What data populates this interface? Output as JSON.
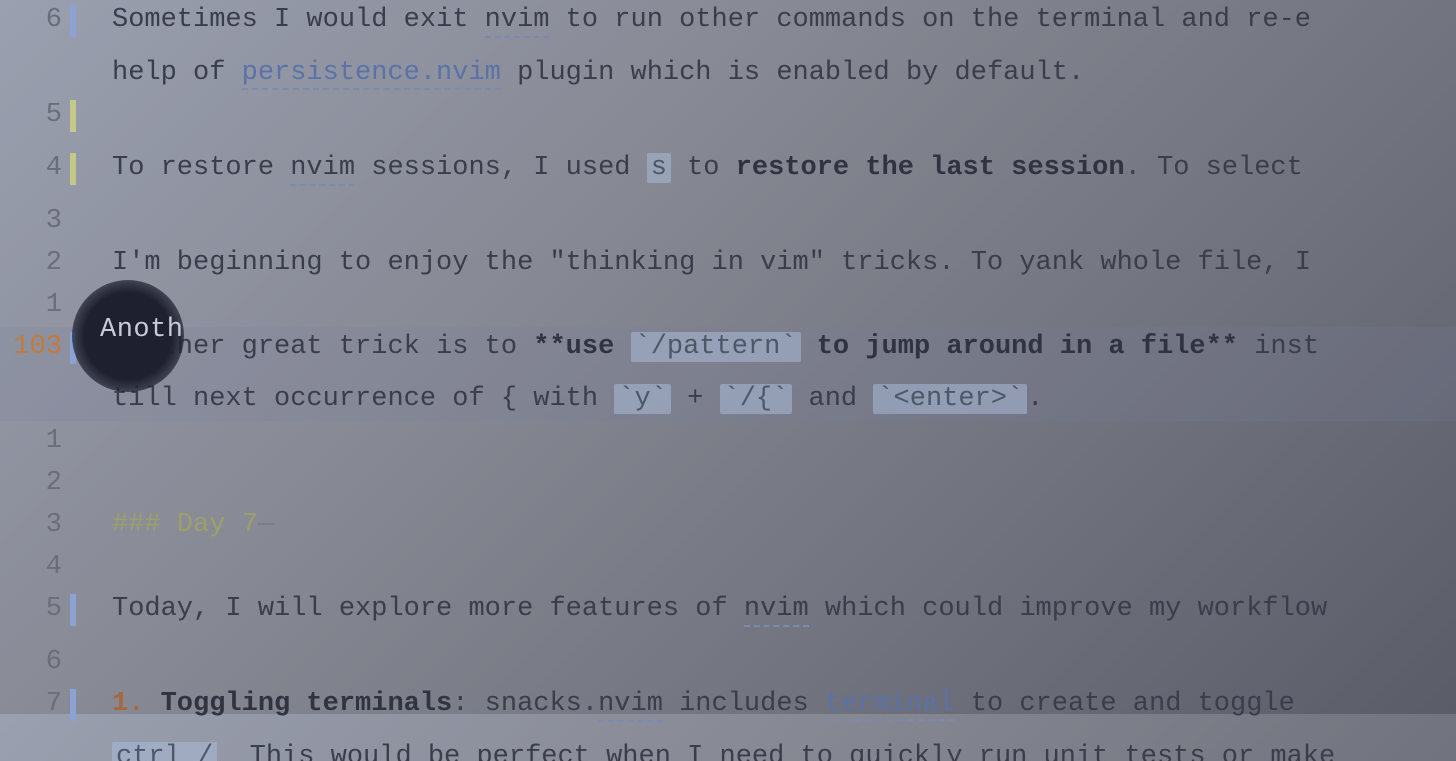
{
  "editor": {
    "current_line_number": "103",
    "lines": [
      {
        "rel": "6",
        "marker": "blue",
        "segments": [
          {
            "t": "Sometimes I would exit "
          },
          {
            "t": "nvim",
            "cls": "underline-dash"
          },
          {
            "t": " to run other commands on the terminal and re-e"
          }
        ]
      },
      {
        "rel": "",
        "segments": [
          {
            "t": "help of "
          },
          {
            "t": "persistence.nvim",
            "cls": "link"
          },
          {
            "t": " plugin which is enabled by default."
          }
        ]
      },
      {
        "rel": "5",
        "marker": "yellow",
        "segments": [
          {
            "t": ""
          }
        ]
      },
      {
        "rel": "4",
        "marker": "yellow",
        "segments": [
          {
            "t": "To restore "
          },
          {
            "t": "nvim",
            "cls": "underline-dash"
          },
          {
            "t": " sessions, I used "
          },
          {
            "t": "s",
            "cls": "hl-key"
          },
          {
            "t": " to "
          },
          {
            "t": "restore the last session",
            "cls": "bold"
          },
          {
            "t": ". To select "
          }
        ]
      },
      {
        "rel": "3",
        "segments": [
          {
            "t": ""
          }
        ]
      },
      {
        "rel": "2",
        "segments": [
          {
            "t": "I'm beginning to enjoy the \"thinking in vim\" tricks. To yank whole file, I"
          }
        ]
      },
      {
        "rel": "1",
        "segments": [
          {
            "t": ""
          }
        ]
      },
      {
        "rel": "103",
        "current": true,
        "marker": "blue",
        "segments": [
          {
            "cursor": true
          },
          {
            "t": "Another great trick is to "
          },
          {
            "t": "**use ",
            "cls": "bold"
          },
          {
            "t": "`/pattern`",
            "cls": "hl-key"
          },
          {
            "t": " to jump around in a file**",
            "cls": "bold"
          },
          {
            "t": " inst"
          }
        ]
      },
      {
        "rel": "",
        "current": true,
        "segments": [
          {
            "t": "till next occurrence of { with "
          },
          {
            "t": "`y`",
            "cls": "hl-key"
          },
          {
            "t": " + "
          },
          {
            "t": "`/{`",
            "cls": "hl-key"
          },
          {
            "t": " and "
          },
          {
            "t": "`<enter>`",
            "cls": "hl-key"
          },
          {
            "t": "."
          }
        ]
      },
      {
        "rel": "1",
        "segments": [
          {
            "t": ""
          }
        ]
      },
      {
        "rel": "2",
        "segments": [
          {
            "t": ""
          }
        ]
      },
      {
        "rel": "3",
        "segments": [
          {
            "t": "### Day 7",
            "cls": "heading"
          },
          {
            "t": "—",
            "cls": "trail"
          }
        ]
      },
      {
        "rel": "4",
        "segments": [
          {
            "t": ""
          }
        ]
      },
      {
        "rel": "5",
        "marker": "blue",
        "segments": [
          {
            "t": "Today, I will explore more features of "
          },
          {
            "t": "nvim",
            "cls": "underline-dash"
          },
          {
            "t": " which could improve my workflow"
          }
        ]
      },
      {
        "rel": "6",
        "segments": [
          {
            "t": ""
          }
        ]
      },
      {
        "rel": "7",
        "marker": "blue",
        "segments": [
          {
            "t": "1. ",
            "cls": "num-list"
          },
          {
            "t": "Toggling terminals",
            "cls": "bold"
          },
          {
            "t": ": snacks."
          },
          {
            "t": "nvim",
            "cls": "underline-dash"
          },
          {
            "t": " includes "
          },
          {
            "t": "terminal",
            "cls": "link"
          },
          {
            "t": " to create and toggle "
          }
        ]
      },
      {
        "rel": "",
        "segments": [
          {
            "t": "ctrl /",
            "cls": "hl-key"
          },
          {
            "t": "  This would be perfect when I need to quickly run unit tests or make"
          }
        ]
      }
    ]
  },
  "spotlight_overlay_text": "Anoth"
}
